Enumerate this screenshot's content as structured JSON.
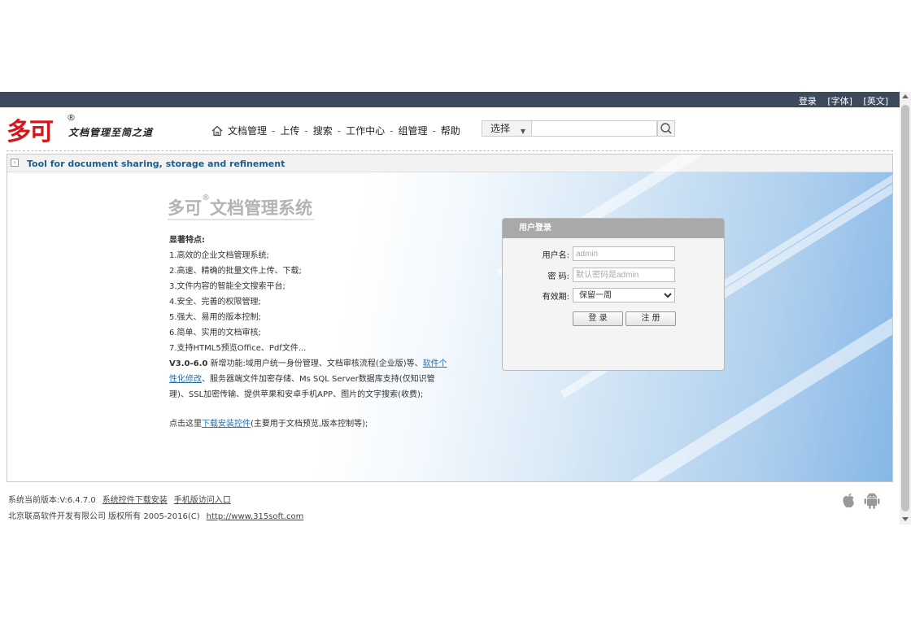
{
  "topbar": {
    "login": "登录",
    "font": "[字体]",
    "english": "[英文]"
  },
  "header": {
    "logo_text": "多可",
    "logo_reg": "®",
    "slogan": "文档管理至简之道",
    "nav": [
      "文档管理",
      "上传",
      "搜索",
      "工作中心",
      "组管理",
      "帮助"
    ],
    "nav_sep": "-",
    "search_select": "选择",
    "search_value": ""
  },
  "strip": {
    "text": "Tool for document sharing, storage and refinement"
  },
  "hero": {
    "title_brand": "多可",
    "title_reg": "®",
    "title_rest": "文档管理系统",
    "features_heading": "显著特点:",
    "features": [
      "1.高效的企业文档管理系统;",
      "2.高速、精确的批量文件上传、下载;",
      "3.文件内容的智能全文搜索平台;",
      "4.安全、完善的权限管理;",
      "5.强大、易用的版本控制;",
      "6.简单、实用的文档审核;",
      "7.支持HTML5预览Office、Pdf文件..."
    ],
    "version_label": "V3.0-6.0",
    "version_text1": " 新增功能:域用户统一身份管理、文档审核流程(企业版)等、",
    "version_link": "软件个性化修改",
    "version_text2": "、服务器端文件加密存储、Ms SQL Server数据库支持(仅知识管理)、SSL加密传输、提供苹果和安卓手机APP、图片的文字搜索(收费);",
    "download_pre": "点击这里",
    "download_link": "下载安装控件",
    "download_post": "(主要用于文档预览,版本控制等);"
  },
  "login": {
    "title": "用户登录",
    "username_label": "用户名:",
    "username_placeholder": "admin",
    "password_label": "密  码:",
    "password_placeholder": "默认密码是admin",
    "validity_label": "有效期:",
    "validity_selected": "保留一周",
    "login_button": "登 录",
    "register_button": "注 册"
  },
  "footer": {
    "version": "系统当前版本:V:6.4.7.0",
    "download_plugin": "系统控件下载安装",
    "mobile_entry": "手机版访问入口",
    "copyright": "北京联高软件开发有限公司 版权所有 2005-2016(C)",
    "site_url": "http://www.315soft.com"
  },
  "colors": {
    "brand_red": "#d4161b",
    "topbar_bg": "#3d4a5c",
    "link_blue": "#1f6fb0"
  }
}
